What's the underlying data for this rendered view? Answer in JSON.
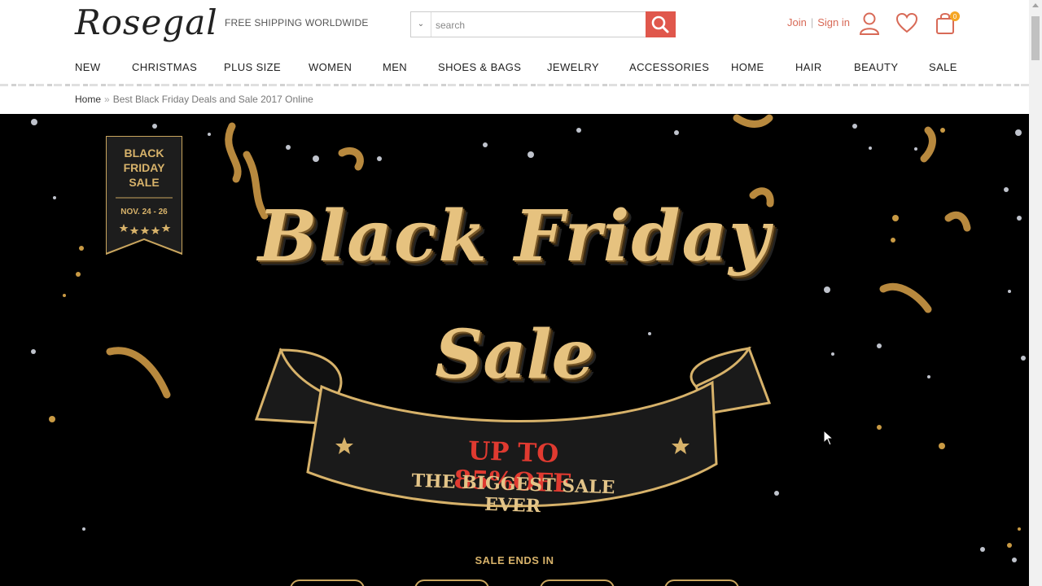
{
  "header": {
    "logo": "Rosegal",
    "shipping": "FREE SHIPPING WORLDWIDE",
    "search": {
      "placeholder": "search"
    },
    "join": "Join",
    "sign_in": "Sign in",
    "separator": "|",
    "cart_count": "0"
  },
  "nav": [
    "NEW",
    "CHRISTMAS",
    "PLUS SIZE",
    "WOMEN",
    "MEN",
    "SHOES & BAGS",
    "JEWELRY",
    "ACCESSORIES",
    "HOME",
    "HAIR",
    "BEAUTY",
    "SALE"
  ],
  "breadcrumb": {
    "home": "Home",
    "separator": "»",
    "current": "Best Black Friday Deals and Sale 2017 Online"
  },
  "banner": {
    "flag_line1": "BLACK",
    "flag_line2": "FRIDAY",
    "flag_line3": "SALE",
    "flag_dates": "NOV. 24 - 26",
    "headline1": "Black Friday",
    "headline2": "Sale",
    "offer": "UP TO 85%OFF",
    "tagline": "THE BIGGEST SALE EVER",
    "ends": "SALE ENDS IN"
  },
  "colors": {
    "accent": "#e0574c",
    "gold": "#d7b26a",
    "banner_bg": "#000000",
    "offer_red": "#e03a30"
  }
}
